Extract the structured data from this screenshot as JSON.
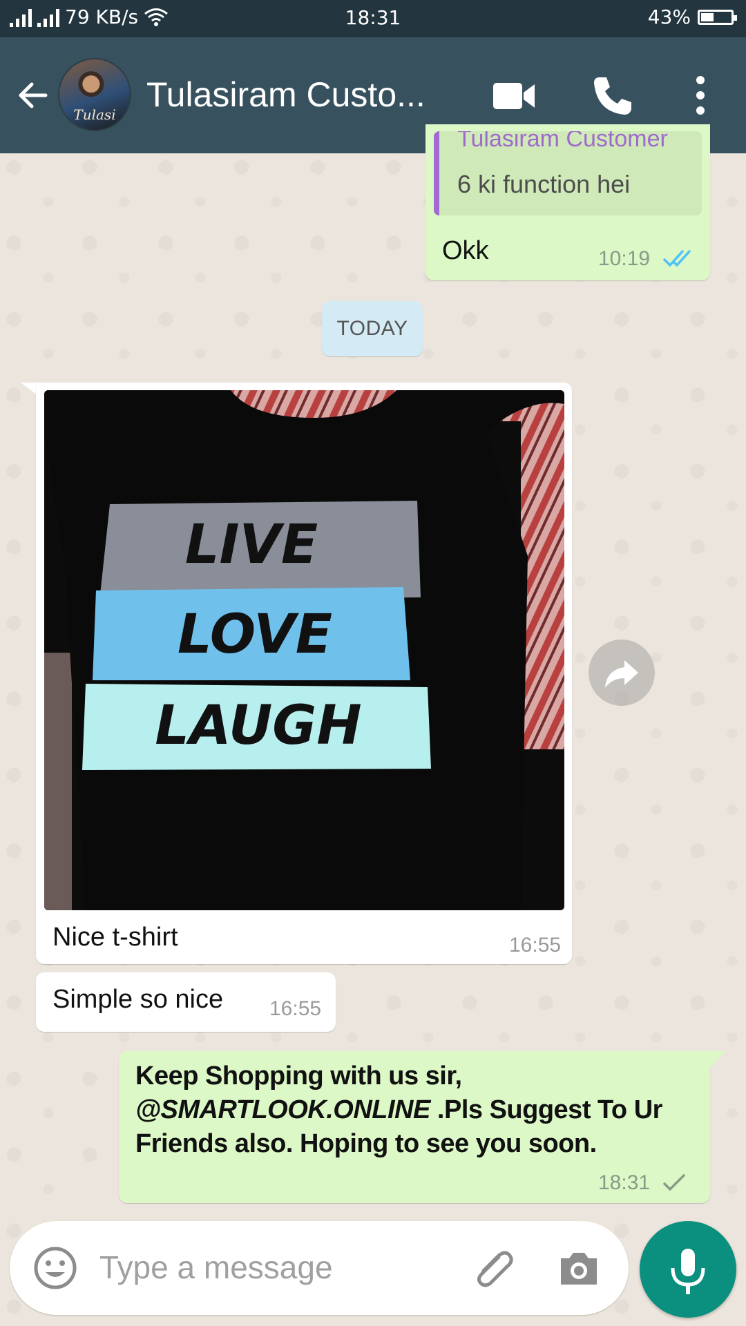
{
  "status_bar": {
    "network_speed": "79 KB/s",
    "time": "18:31",
    "battery_percent": "43%",
    "battery_level": 0.43
  },
  "header": {
    "contact_name": "Tulasiram Custo...",
    "avatar_signature": "Tulasi"
  },
  "messages": {
    "m1": {
      "quoted_name": "Tulasiram Customer",
      "quoted_text": "6 ki function hei",
      "text": "Okk",
      "time": "10:19",
      "status": "read"
    },
    "date_separator": "TODAY",
    "m2": {
      "image_text": [
        "LIVE",
        "LOVE",
        "LAUGH"
      ],
      "caption": "Nice t-shirt",
      "time": "16:55"
    },
    "m3": {
      "text": "Simple so nice",
      "time": "16:55"
    },
    "m4": {
      "line1": "Keep Shopping with us sir,",
      "handle": "@SMARTLOOK.ONLINE",
      "line2_rest": " .Pls Suggest To Ur",
      "line3": "Friends also. Hoping to see you soon.",
      "time": "18:31",
      "status": "sent"
    }
  },
  "composer": {
    "placeholder": "Type a message"
  },
  "colors": {
    "header": "#37525e",
    "status_bar": "#233640",
    "outgoing_bubble": "#dcf8c6",
    "incoming_bubble": "#ffffff",
    "read_ticks": "#4fc3f7",
    "mic_button": "#0b8f7e"
  },
  "icons": [
    "back-arrow-icon",
    "video-call-icon",
    "phone-icon",
    "more-vert-icon",
    "forward-icon",
    "emoji-icon",
    "attach-icon",
    "camera-icon",
    "mic-icon",
    "double-check-icon",
    "single-check-icon",
    "wifi-icon",
    "signal-icon",
    "battery-icon"
  ]
}
